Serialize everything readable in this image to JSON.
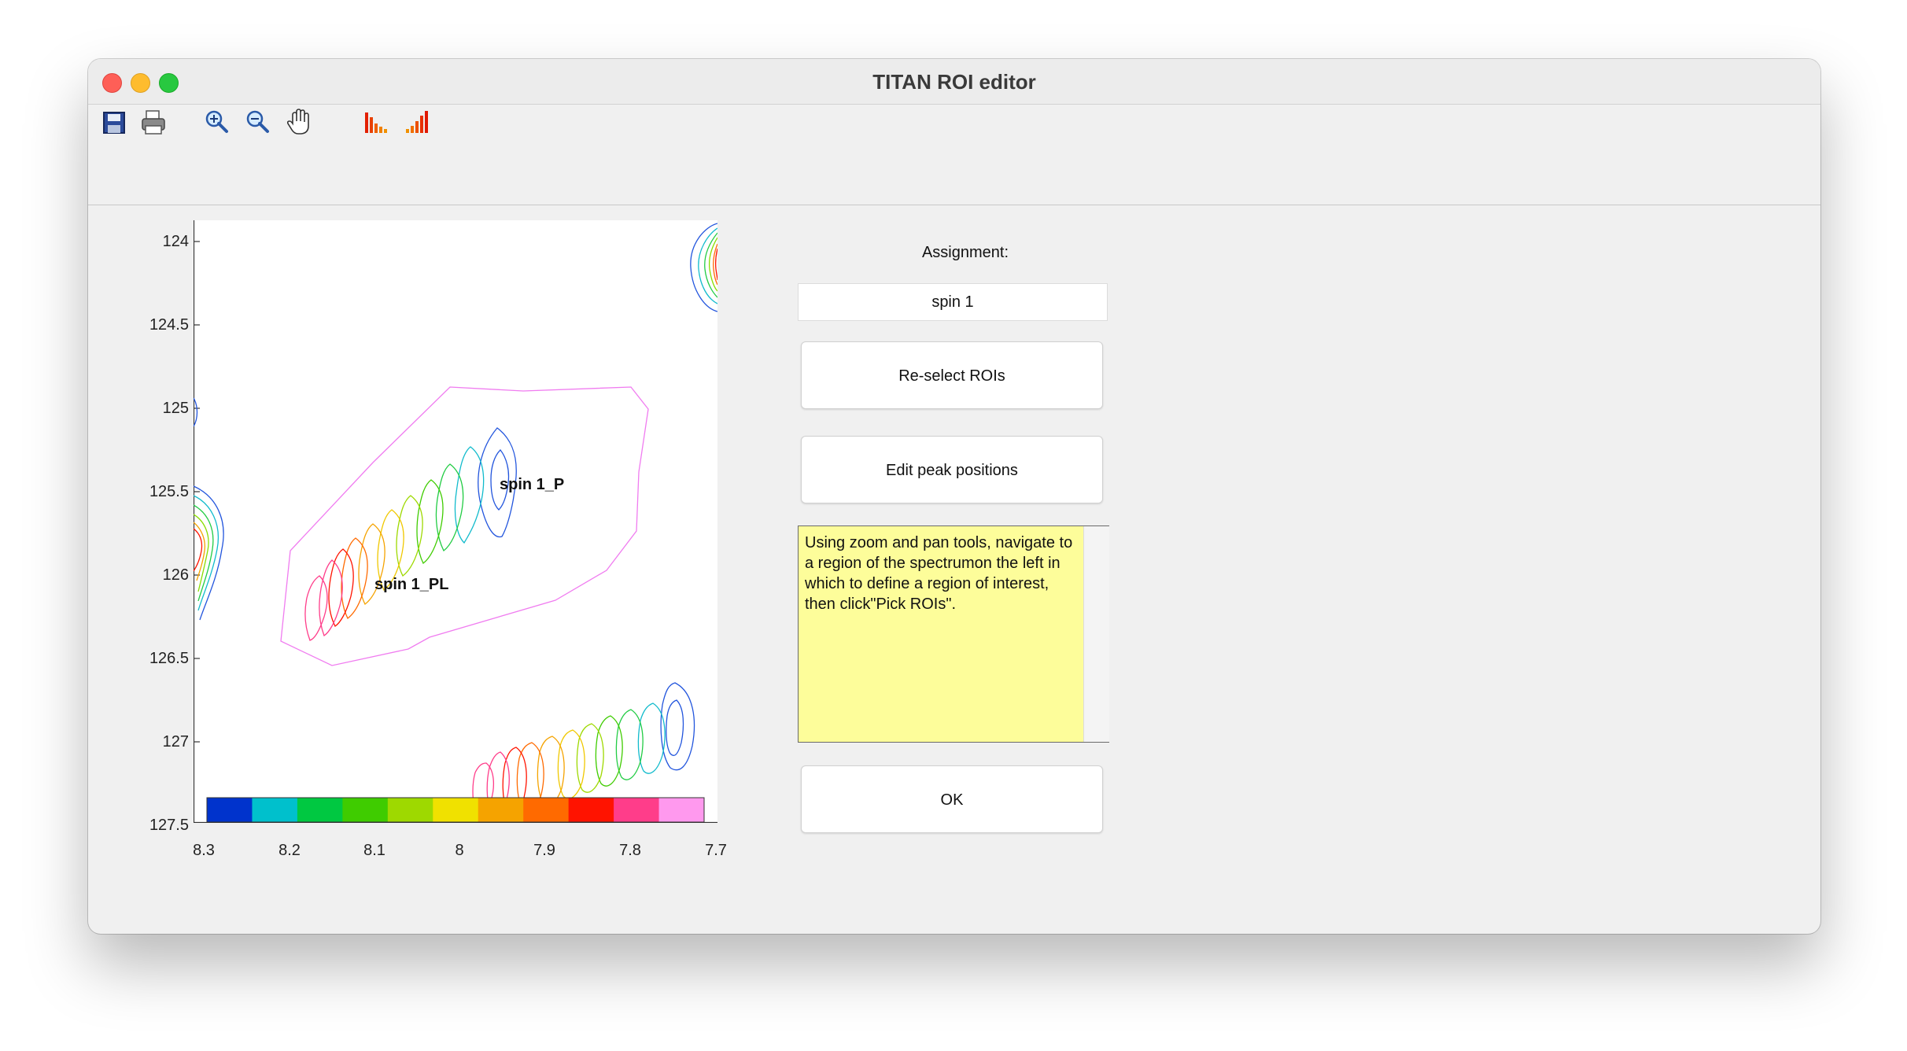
{
  "window": {
    "title": "TITAN ROI editor"
  },
  "toolbar": {
    "icons": [
      "save-icon",
      "print-icon",
      "zoom-in-icon",
      "zoom-out-icon",
      "pan-hand-icon",
      "bar-chart-icon",
      "signal-bars-icon"
    ]
  },
  "plot": {
    "y_ticks": [
      "124",
      "124.5",
      "125",
      "125.5",
      "126",
      "126.5",
      "127",
      "127.5"
    ],
    "x_ticks": [
      "8.3",
      "8.2",
      "8.1",
      "8",
      "7.9",
      "7.8",
      "7.7"
    ],
    "labels": {
      "peak_p": "spin 1_P",
      "peak_pl": "spin 1_PL"
    },
    "colorbar": [
      "#0033cc",
      "#00c0cc",
      "#00c841",
      "#3fcc00",
      "#9ed900",
      "#f0e100",
      "#f5a300",
      "#ff6a00",
      "#ff1300",
      "#ff3d8a",
      "#ff99ee"
    ],
    "x_range": [
      8.3,
      7.7
    ],
    "y_range": [
      123.9,
      127.5
    ]
  },
  "panel": {
    "assignment_label": "Assignment:",
    "assignment_value": "spin 1",
    "reselect_button": "Re-select ROIs",
    "edit_button": "Edit peak positions",
    "info_text": "Using zoom and pan tools, navigate to a region of the spectrumon the left in which to define a region of interest, then click\"Pick ROIs\".",
    "ok_button": "OK"
  }
}
